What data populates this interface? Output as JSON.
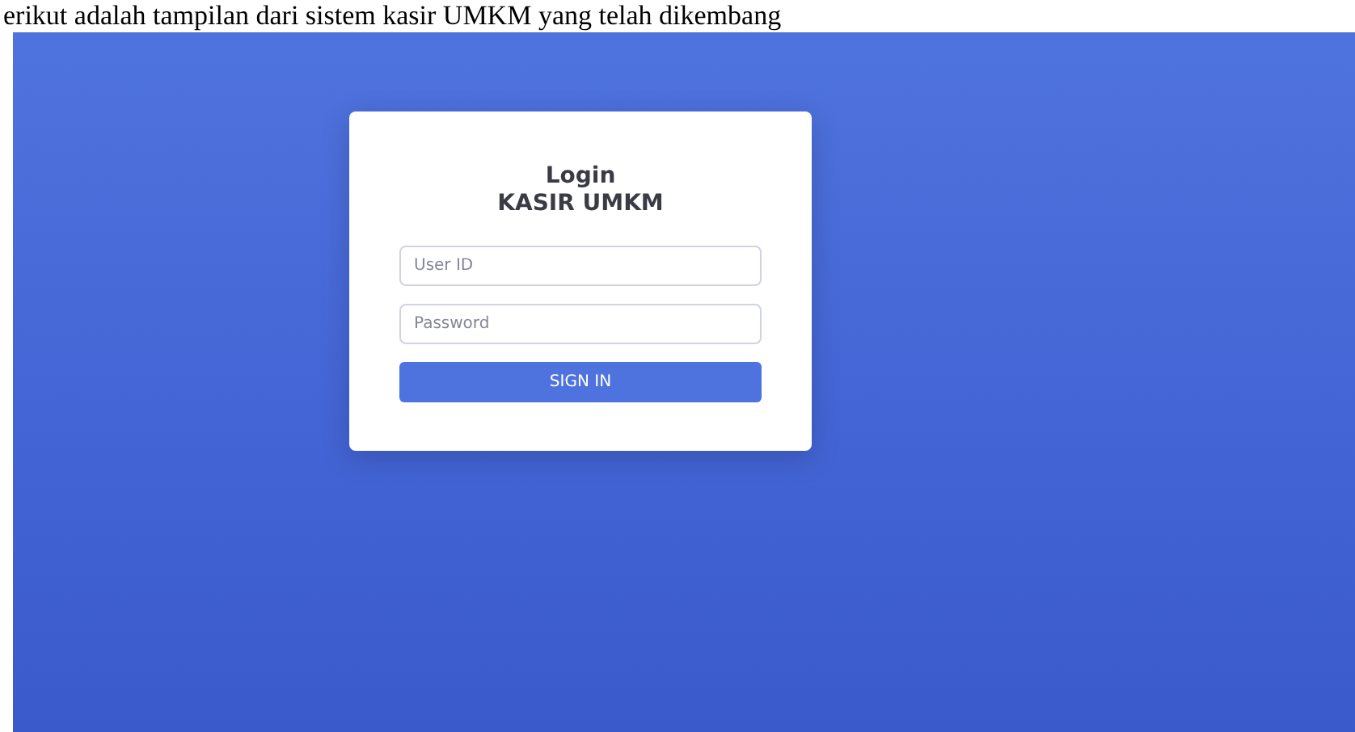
{
  "caption": "erikut adalah tampilan dari sistem kasir UMKM yang telah dikembang",
  "login": {
    "title": "Login",
    "subtitle": "KASIR UMKM",
    "fields": [
      {
        "placeholder": "User ID"
      },
      {
        "placeholder": "Password"
      }
    ],
    "button": "SIGN IN"
  }
}
